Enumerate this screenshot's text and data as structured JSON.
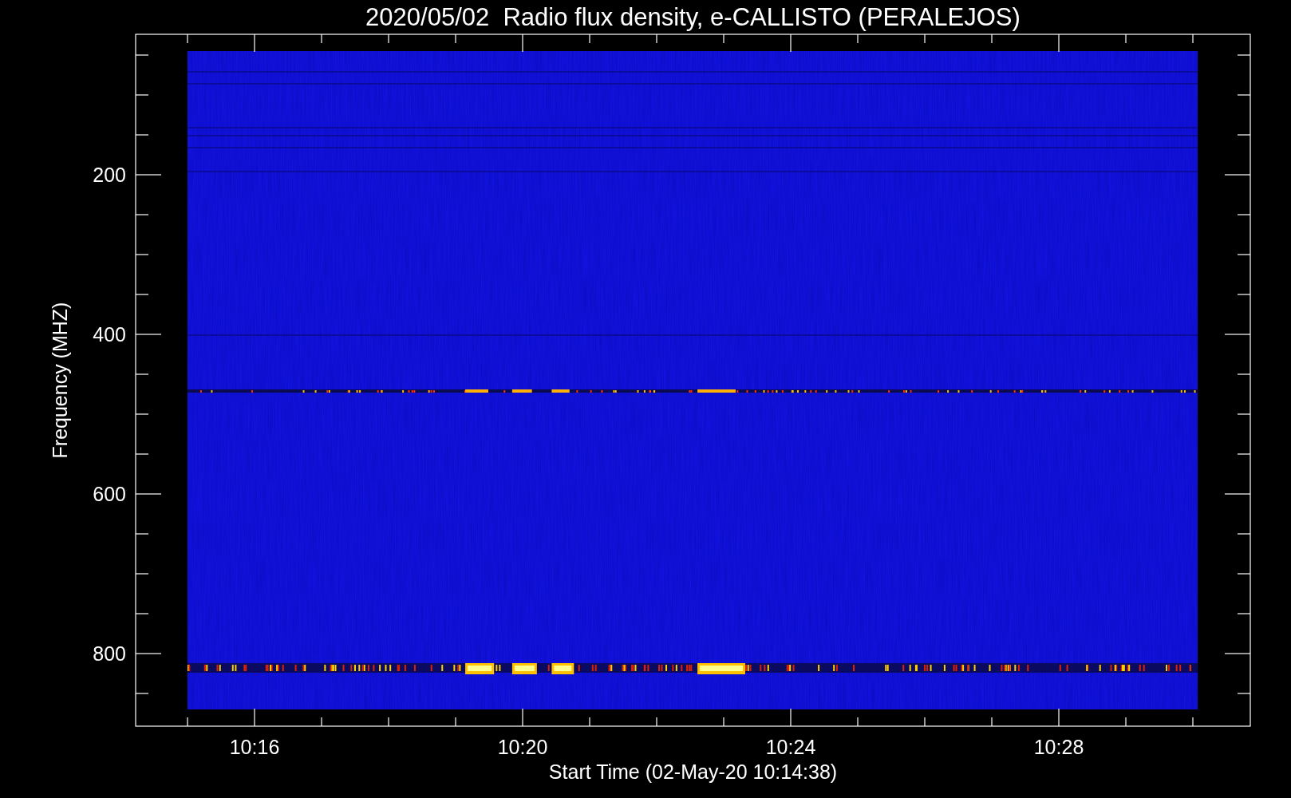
{
  "title": "2020/05/02  Radio flux density, e-CALLISTO (PERALEJOS)",
  "y_axis": {
    "label": "Frequency (MHZ)",
    "ticks": [
      "200",
      "400",
      "600",
      "800"
    ]
  },
  "x_axis": {
    "label": "Start Time (02-May-20 10:14:38)",
    "ticks": [
      "10:16",
      "10:20",
      "10:24",
      "10:28"
    ]
  }
}
